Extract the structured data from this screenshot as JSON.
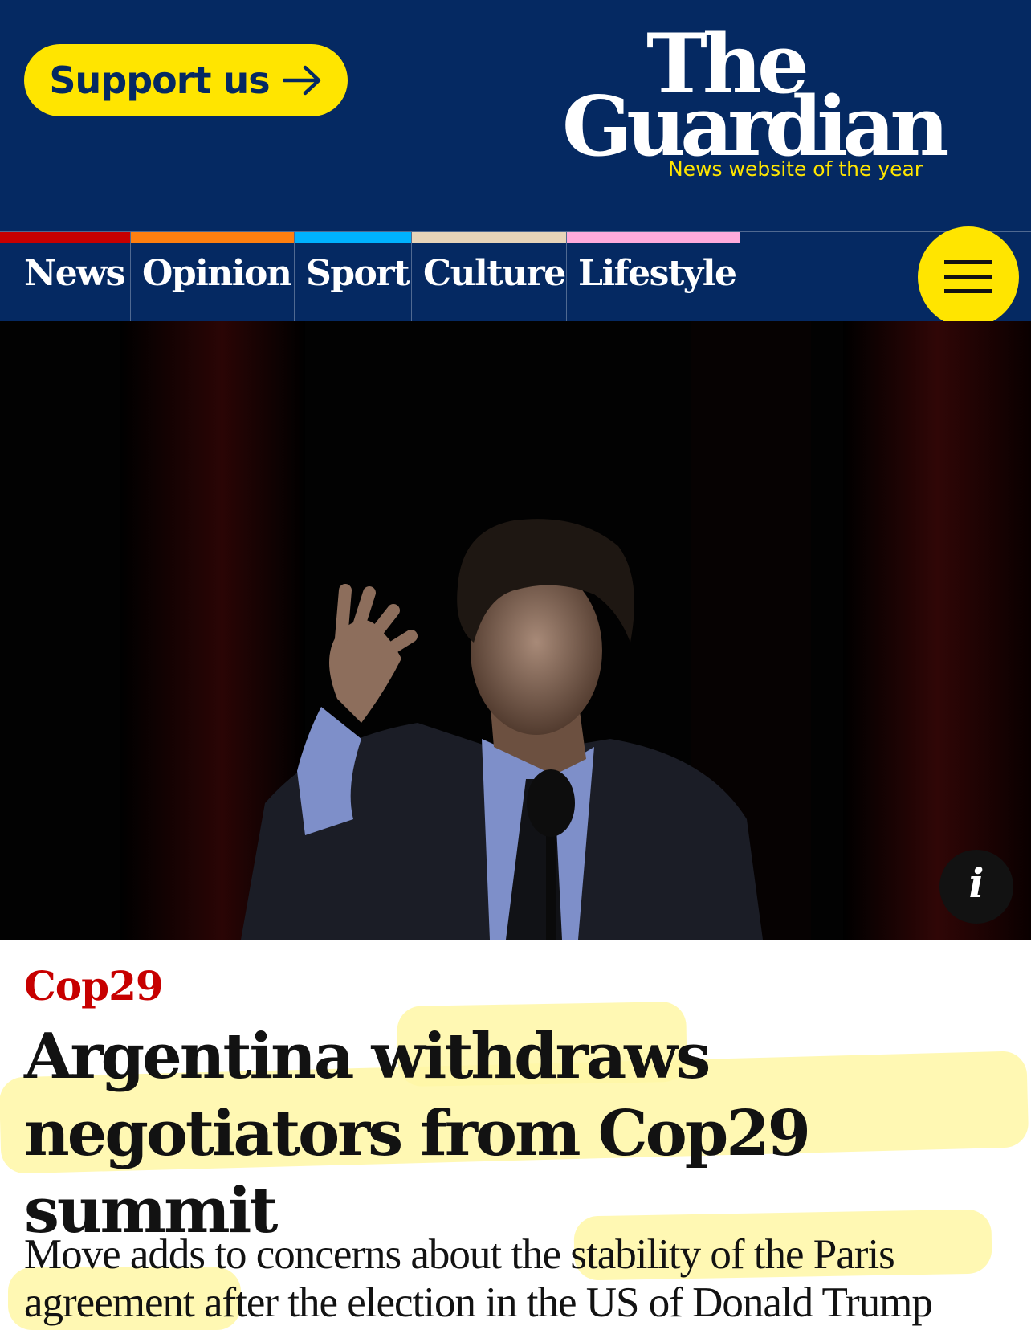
{
  "header": {
    "support_label": "Support us",
    "support_icon": "arrow-right-icon",
    "logo_line1": "The",
    "logo_line2": "Guardian",
    "logo_tagline": "News website of the year"
  },
  "nav": {
    "items": [
      {
        "label": "News",
        "color": "#c70000"
      },
      {
        "label": "Opinion",
        "color": "#ff7f0f"
      },
      {
        "label": "Sport",
        "color": "#00b2ff"
      },
      {
        "label": "Culture",
        "color": "#e7d4b9"
      },
      {
        "label": "Lifestyle",
        "color": "#ffabdb"
      }
    ],
    "menu_icon": "hamburger-menu-icon"
  },
  "photo": {
    "info_label": "i",
    "info_icon": "info-icon"
  },
  "article": {
    "kicker": "Cop29",
    "headline": "Argentina withdraws negotiators from Cop29 summit",
    "standfirst": "Move adds to concerns about the stability of the Paris agreement after the election in the US of Donald Trump"
  },
  "colors": {
    "brand_blue": "#052962",
    "support_yellow": "#ffe500",
    "kicker_red": "#c70000",
    "highlighter": "#fff7a6"
  }
}
